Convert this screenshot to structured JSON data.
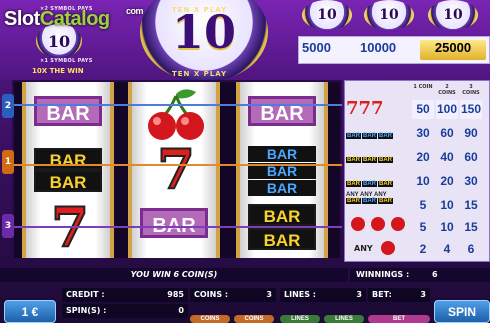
{
  "watermark": {
    "slot": "Slot",
    "catalog": "Catalog",
    "com": "com"
  },
  "header": {
    "logo_number": "10",
    "logo_rim_top": "TEN X PLAY",
    "logo_rim_bottom": "TEN X PLAY",
    "small_logo_number": "10",
    "symbol_note_2": "×2 SYMBOL PAYS",
    "symbol_note_1": "×1 SYMBOL PAYS",
    "win_multiplier": "10X THE WIN",
    "mini_logos": [
      "10",
      "10",
      "10"
    ]
  },
  "jackpots": [
    "5000",
    "10000",
    "25000"
  ],
  "reels": [
    [
      "BAR",
      "BAR",
      "BAR",
      "7"
    ],
    [
      "cherries",
      "7",
      "BAR"
    ],
    [
      "BAR",
      "BAR",
      "BAR",
      "BAR",
      "BAR",
      "BAR"
    ]
  ],
  "paylines": [
    "2",
    "1",
    "3"
  ],
  "paytable": {
    "headers": [
      "1\nCOIN",
      "2\nCOINS",
      "3\nCOINS"
    ],
    "rows": [
      {
        "symbol": "777",
        "values": [
          "50",
          "100",
          "150"
        ]
      },
      {
        "symbol": "BAR BAR BAR (blue)",
        "values": [
          "30",
          "60",
          "90"
        ]
      },
      {
        "symbol": "BAR BAR BAR (yellow)",
        "values": [
          "20",
          "40",
          "60"
        ]
      },
      {
        "symbol": "BAR BAR BAR (mixed)",
        "values": [
          "10",
          "20",
          "30"
        ]
      },
      {
        "symbol": "ANY ANY ANY",
        "values": [
          "5",
          "10",
          "15"
        ]
      },
      {
        "symbol": "cherries x3",
        "values": [
          "5",
          "10",
          "15"
        ]
      },
      {
        "symbol": "ANY cherry",
        "values": [
          "2",
          "4",
          "6"
        ]
      }
    ],
    "any_label": "ANY"
  },
  "status": {
    "message": "YOU WIN 6 COIN(S)",
    "winnings_label": "WINNINGS :",
    "winnings_value": "6"
  },
  "panel": {
    "credit_label": "CREDIT :",
    "credit_value": "985",
    "coins_label": "COINS :",
    "coins_value": "3",
    "lines_label": "LINES :",
    "lines_value": "3",
    "bet_label": "BET:",
    "bet_value": "3",
    "spins_label": "SPIN(S) :",
    "spins_value": "0"
  },
  "buttons": {
    "coin_value": "1 €",
    "spin": "SPIN",
    "coins": "COINS",
    "coins2": "COINS",
    "lines": "LINES",
    "lines2": "LINES",
    "bet": "BET"
  },
  "colors": {
    "accent": "#5b1d8f",
    "paytable_text": "#1a3d9a",
    "jackpot_gold": "#e1b12c"
  }
}
